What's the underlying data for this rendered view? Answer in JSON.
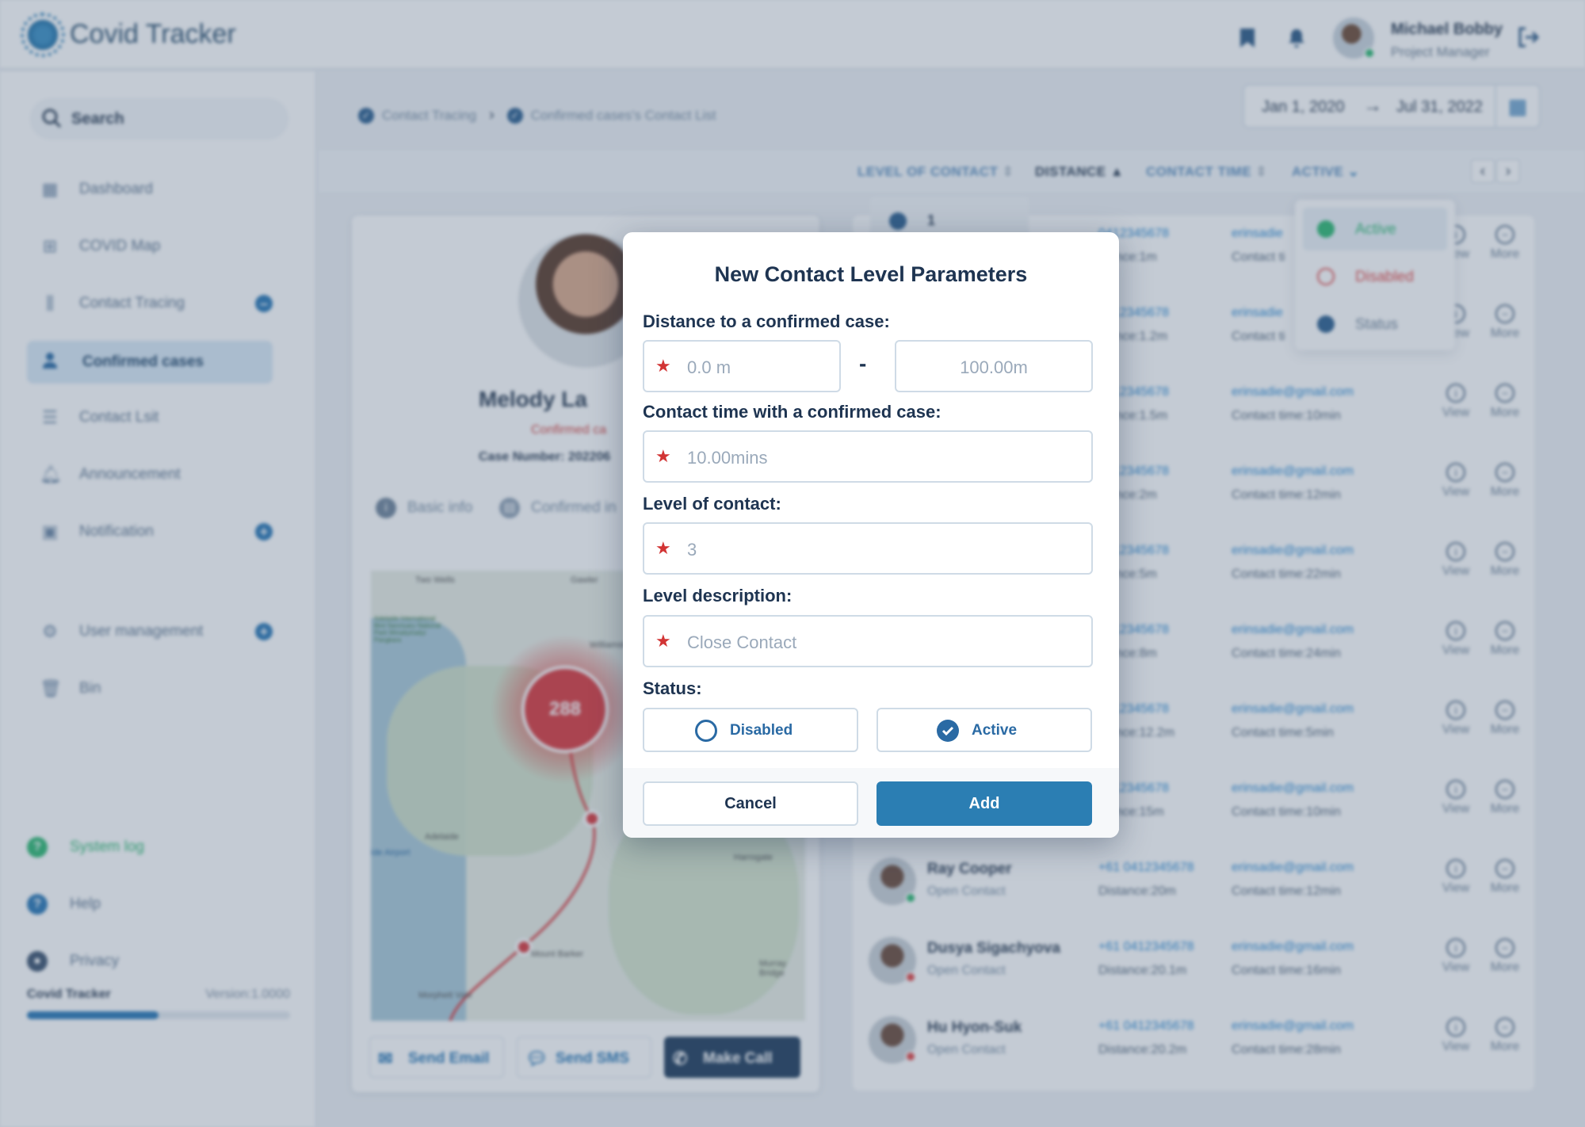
{
  "app": {
    "name": "Covid Tracker"
  },
  "header": {
    "user_name": "Michael Bobby",
    "user_role": "Project Manager"
  },
  "sidebar": {
    "search_label": "Search",
    "items": [
      {
        "label": "Dashboard",
        "icon": "dashboard-icon"
      },
      {
        "label": "COVID Map",
        "icon": "map-icon"
      },
      {
        "label": "Contact Tracing",
        "icon": "tracing-icon",
        "badge": "–"
      },
      {
        "label": "Confirmed cases",
        "icon": "person-icon",
        "active": true
      },
      {
        "label": "Contact Lsit",
        "icon": "list-icon"
      },
      {
        "label": "Announcement",
        "icon": "bell-icon"
      },
      {
        "label": "Notification",
        "icon": "notification-icon",
        "badge": "+"
      },
      {
        "label": "User management",
        "icon": "user-management-icon",
        "badge": "+"
      },
      {
        "label": "Bin",
        "icon": "trash-icon"
      }
    ],
    "footer": [
      {
        "label": "System log",
        "color": "#2eb872"
      },
      {
        "label": "Help",
        "color": "#2977b5"
      },
      {
        "label": "Privacy",
        "color": "#3d5470"
      }
    ],
    "version_name": "Covid Tracker",
    "version_label": "Version:1.0000",
    "version_progress": 0.5
  },
  "breadcrumb": {
    "first": "Contact Tracing",
    "second": "Confirmed cases's Contact List"
  },
  "date_range": {
    "start": "Jan 1, 2020",
    "end": "Jul 31, 2022"
  },
  "filters": {
    "level": "LEVEL OF CONTACT",
    "distance": "DISTANCE",
    "contact_time": "CONTACT TIME",
    "active": "ACTIVE"
  },
  "level_popup_value": "1",
  "status_menu": [
    {
      "label": "Active",
      "color": "#2eb872"
    },
    {
      "label": "Disabled",
      "color": "#e04848"
    },
    {
      "label": "Status",
      "color": "#2c5f8f"
    }
  ],
  "profile": {
    "name": "Melody La",
    "status": "Confirmed ca",
    "case_number": "Case Number:  202206",
    "tab_basic": "Basic info",
    "tab_confirmed": "Confirmed in",
    "cluster_count": "288",
    "map_labels": [
      "Two Wells",
      "Gawler",
      "Adelaide International Bird Sanctuary National Park Winaityinaityi Pangkara",
      "Williamstown",
      "Adelaide",
      "Harrogate",
      "Mount Barker",
      "Morphett Vale",
      "Murray Bridge",
      "ide Airport"
    ],
    "btn_email": "Send Email",
    "btn_sms": "Send SMS",
    "btn_call": "Make Call"
  },
  "contacts": [
    {
      "name": "",
      "type": "",
      "phone": "0412345678",
      "distance": "stance:1m",
      "email": "erinsadie",
      "time": "Contact ti"
    },
    {
      "name": "",
      "type": "",
      "phone": "0412345678",
      "distance": "stance:1.2m",
      "email": "erinsadie",
      "time": "Contact ti"
    },
    {
      "name": "",
      "type": "",
      "phone": "0412345678",
      "distance": "stance:1.5m",
      "email": "erinsadie@gmail.com",
      "time": "Contact time:10min"
    },
    {
      "name": "",
      "type": "",
      "phone": "0412345678",
      "distance": "stance:2m",
      "email": "erinsadie@gmail.com",
      "time": "Contact time:12min"
    },
    {
      "name": "",
      "type": "",
      "phone": "0412345678",
      "distance": "stance:5m",
      "email": "erinsadie@gmail.com",
      "time": "Contact time:22min"
    },
    {
      "name": "",
      "type": "",
      "phone": "0412345678",
      "distance": "stance:8m",
      "email": "erinsadie@gmail.com",
      "time": "Contact time:24min"
    },
    {
      "name": "",
      "type": "",
      "phone": "0412345678",
      "distance": "stance:12.2m",
      "email": "erinsadie@gmail.com",
      "time": "Contact time:5min"
    },
    {
      "name": "",
      "type": "",
      "phone": "0412345678",
      "distance": "stance:15m",
      "email": "erinsadie@gmail.com",
      "time": "Contact time:10min"
    },
    {
      "name": "Ray Cooper",
      "type": "Open Contact",
      "phone": "+61 0412345678",
      "distance": "Distance:20m",
      "email": "erinsadie@gmail.com",
      "time": "Contact time:12min",
      "dot": "#2eb872"
    },
    {
      "name": "Dusya Sigachyova",
      "type": "Open Contact",
      "phone": "+61 0412345678",
      "distance": "Distance:20.1m",
      "email": "erinsadie@gmail.com",
      "time": "Contact time:16min",
      "dot": "#e04848"
    },
    {
      "name": "Hu Hyon-Suk",
      "type": "Open Contact",
      "phone": "+61 0412345678",
      "distance": "Distance:20.2m",
      "email": "erinsadie@gmail.com",
      "time": "Contact time:28min",
      "dot": "#e04848"
    }
  ],
  "row_actions": {
    "view": "View",
    "more": "More"
  },
  "modal": {
    "title": "New Contact Level Parameters",
    "distance_label": "Distance to a confirmed case:",
    "distance_min_placeholder": "0.0 m",
    "distance_separator": "-",
    "distance_max_placeholder": "100.00m",
    "contact_time_label": "Contact time with a confirmed case:",
    "contact_time_placeholder": "10.00mins",
    "level_label": "Level of contact:",
    "level_placeholder": "3",
    "description_label": "Level description:",
    "description_placeholder": "Close Contact",
    "status_label": "Status:",
    "status_disabled": "Disabled",
    "status_active": "Active",
    "selected_status": "Active",
    "cancel_label": "Cancel",
    "add_label": "Add",
    "accent_color": "#2b7eb3"
  }
}
